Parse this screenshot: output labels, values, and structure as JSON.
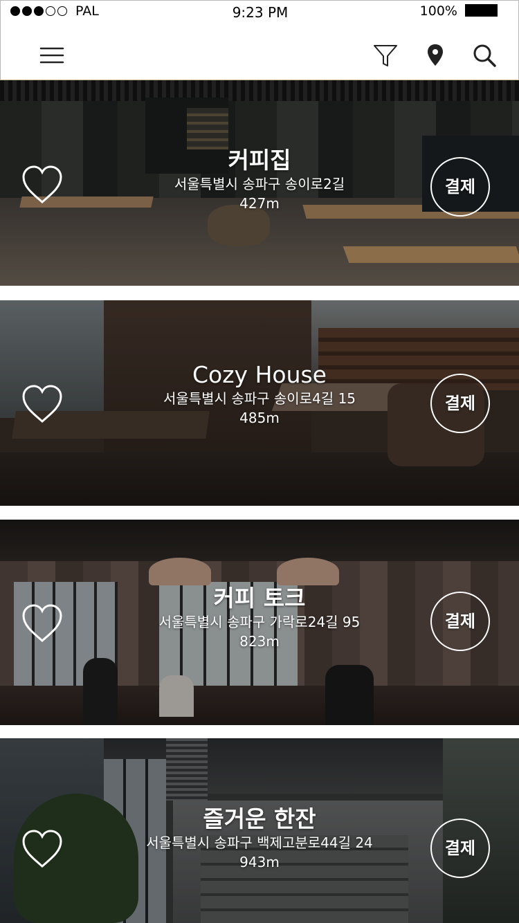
{
  "status_bar": {
    "carrier": "PAL",
    "time": "9:23 PM",
    "battery": "100%"
  },
  "nav": {
    "menu_icon": "hamburger-menu-icon",
    "filter_icon": "filter-funnel-icon",
    "location_icon": "map-pin-icon",
    "search_icon": "search-icon"
  },
  "colors": {
    "overlay": "#000000",
    "text": "#ffffff",
    "background": "#ffffff"
  },
  "cafes": [
    {
      "name": "커피집",
      "address": "서울특별시 송파구 송이로2길",
      "distance": "427m",
      "pay_label": "결제",
      "favorite_icon": "heart-outline-icon"
    },
    {
      "name": "Cozy House",
      "address": "서울특별시 송파구 송이로4길 15",
      "distance": "485m",
      "pay_label": "결제",
      "favorite_icon": "heart-outline-icon"
    },
    {
      "name": "커피 토크",
      "address": "서울특별시 송파구 가락로24길 95",
      "distance": "823m",
      "pay_label": "결제",
      "favorite_icon": "heart-outline-icon"
    },
    {
      "name": "즐거운 한잔",
      "address": "서울특별시 송파구 백제고분로44길 24",
      "distance": "943m",
      "pay_label": "결제",
      "favorite_icon": "heart-outline-icon"
    }
  ]
}
